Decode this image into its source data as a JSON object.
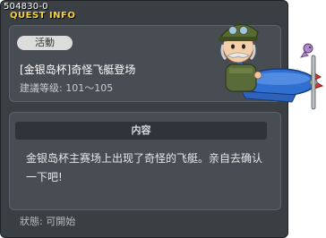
{
  "quest_window": {
    "quest_id": "504830-0",
    "title": "QUEST INFO",
    "category": "活動",
    "quest_name": "[金银岛杯]奇怪飞艇登场",
    "level_range": "建議等级: 101〜105",
    "content_header": "内容",
    "description": "金银岛杯主赛场上出现了奇怪的飞艇。亲自去确认一下吧!",
    "status": "狀態: 可開始"
  },
  "colors": {
    "window_bg": "#3a3f43",
    "panel_bg": "#474d52",
    "title_accent": "#f5d23a",
    "plane_blue": "#2f6fd0"
  },
  "icons": {
    "npc": "pilot-on-blue-plane"
  }
}
